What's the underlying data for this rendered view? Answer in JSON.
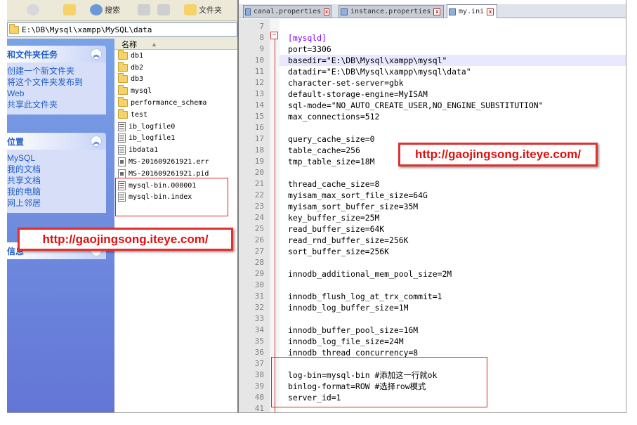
{
  "explorer": {
    "toolbar": {
      "search_label": "搜索",
      "folders_label": "文件夹"
    },
    "address": "E:\\DB\\Mysql\\xampp\\MySQL\\data",
    "tasks_panel": {
      "title": "和文件夹任务",
      "links": [
        "创建一个新文件夹",
        "将这个文件夹发布到",
        "Web",
        "共享此文件夹"
      ]
    },
    "places_panel": {
      "title": "位置",
      "links": [
        "MySQL",
        "我的文档",
        "共享文档",
        "我的电脑",
        "网上邻居"
      ]
    },
    "details_panel": {
      "title": "信息"
    },
    "column_name": "名称",
    "files": [
      {
        "name": "db1",
        "type": "folder"
      },
      {
        "name": "db2",
        "type": "folder"
      },
      {
        "name": "db3",
        "type": "folder"
      },
      {
        "name": "mysql",
        "type": "folder"
      },
      {
        "name": "performance_schema",
        "type": "folder"
      },
      {
        "name": "test",
        "type": "folder"
      },
      {
        "name": "ib_logfile0",
        "type": "log"
      },
      {
        "name": "ib_logfile1",
        "type": "log"
      },
      {
        "name": "ibdata1",
        "type": "log"
      },
      {
        "name": "MS-201609261921.err",
        "type": "err"
      },
      {
        "name": "MS-201609261921.pid",
        "type": "err"
      },
      {
        "name": "mysql-bin.000001",
        "type": "log"
      },
      {
        "name": "mysql-bin.index",
        "type": "log"
      }
    ]
  },
  "editor": {
    "tabs": [
      {
        "label": "canal.properties",
        "active": false
      },
      {
        "label": "instance.properties",
        "active": false
      },
      {
        "label": "my.ini",
        "active": true
      }
    ],
    "lines": [
      {
        "n": "7",
        "text": ""
      },
      {
        "n": "8",
        "text": "[mysqld]"
      },
      {
        "n": "9",
        "text": "port=3306"
      },
      {
        "n": "10",
        "text": "basedir=\"E:\\DB\\Mysql\\xampp\\mysql\""
      },
      {
        "n": "11",
        "text": "datadir=\"E:\\DB\\Mysql\\xampp\\mysql\\data\""
      },
      {
        "n": "12",
        "text": "character-set-server=gbk"
      },
      {
        "n": "13",
        "text": "default-storage-engine=MyISAM"
      },
      {
        "n": "14",
        "text": "sql-mode=\"NO_AUTO_CREATE_USER,NO_ENGINE_SUBSTITUTION\""
      },
      {
        "n": "15",
        "text": "max_connections=512"
      },
      {
        "n": "16",
        "text": ""
      },
      {
        "n": "17",
        "text": "query_cache_size=0"
      },
      {
        "n": "18",
        "text": "table_cache=256"
      },
      {
        "n": "19",
        "text": "tmp_table_size=18M"
      },
      {
        "n": "20",
        "text": ""
      },
      {
        "n": "21",
        "text": "thread_cache_size=8"
      },
      {
        "n": "22",
        "text": "myisam_max_sort_file_size=64G"
      },
      {
        "n": "23",
        "text": "myisam_sort_buffer_size=35M"
      },
      {
        "n": "24",
        "text": "key_buffer_size=25M"
      },
      {
        "n": "25",
        "text": "read_buffer_size=64K"
      },
      {
        "n": "26",
        "text": "read_rnd_buffer_size=256K"
      },
      {
        "n": "27",
        "text": "sort_buffer_size=256K"
      },
      {
        "n": "28",
        "text": ""
      },
      {
        "n": "29",
        "text": "innodb_additional_mem_pool_size=2M"
      },
      {
        "n": "30",
        "text": ""
      },
      {
        "n": "31",
        "text": "innodb_flush_log_at_trx_commit=1"
      },
      {
        "n": "32",
        "text": "innodb_log_buffer_size=1M"
      },
      {
        "n": "33",
        "text": ""
      },
      {
        "n": "34",
        "text": "innodb_buffer_pool_size=16M"
      },
      {
        "n": "35",
        "text": "innodb_log_file_size=24M"
      },
      {
        "n": "36",
        "text": "innodb_thread_concurrency=8"
      },
      {
        "n": "37",
        "text": ""
      },
      {
        "n": "38",
        "text": "log-bin=mysql-bin #添加这一行就ok"
      },
      {
        "n": "39",
        "text": "binlog-format=ROW #选择row模式"
      },
      {
        "n": "40",
        "text": "server_id=1"
      },
      {
        "n": "41",
        "text": ""
      }
    ]
  },
  "watermark": "http://gaojingsong.iteye.com/",
  "colors": {
    "annotation": "#e02020",
    "section": "#8000ff",
    "link": "#215dc6"
  }
}
